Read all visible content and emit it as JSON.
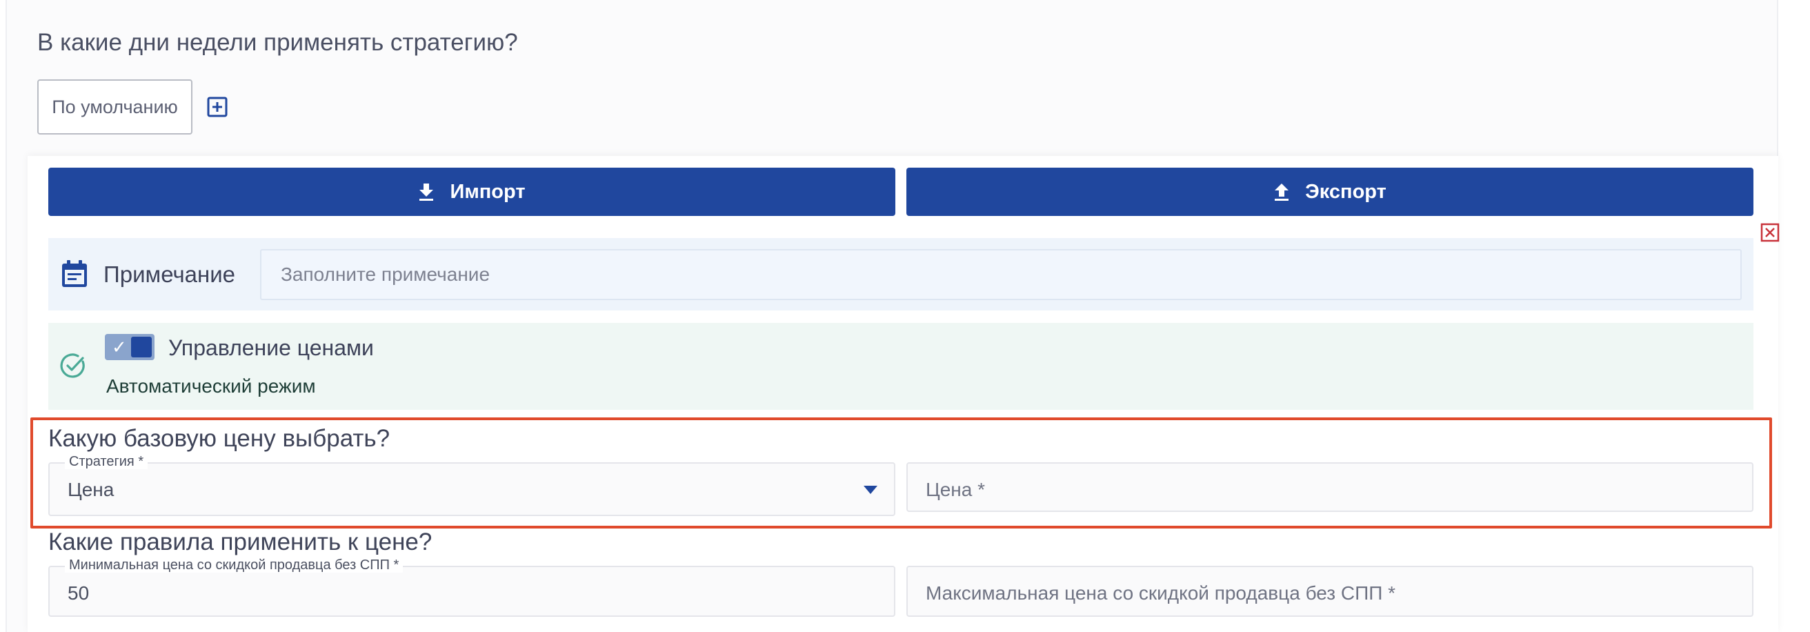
{
  "schedule": {
    "title": "В какие дни недели применять стратегию?",
    "default_chip": "По умолчанию"
  },
  "toolbar": {
    "import_label": "Импорт",
    "export_label": "Экспорт"
  },
  "note": {
    "label": "Примечание",
    "placeholder": "Заполните примечание"
  },
  "price_management": {
    "toggle_label": "Управление ценами",
    "enabled": true,
    "mode": "Автоматический режим"
  },
  "base_price": {
    "title": "Какую базовую цену выбрать?",
    "strategy_legend": "Стратегия *",
    "strategy_value": "Цена",
    "price_placeholder": "Цена *"
  },
  "rules": {
    "title": "Какие правила применить к цене?",
    "min_legend": "Минимальная цена со скидкой продавца без СПП *",
    "min_value": "50",
    "max_placeholder": "Максимальная цена со скидкой продавца без СПП *"
  },
  "colors": {
    "primary": "#20479e",
    "highlight": "#e04a2c",
    "close": "#c8323a",
    "success": "#4aaa96"
  },
  "icons": {
    "add": "plus-square-icon",
    "import": "download-icon",
    "export": "upload-icon",
    "close": "close-square-icon",
    "note": "calendar-note-icon",
    "status": "check-circle-icon",
    "dropdown": "caret-down-icon"
  }
}
